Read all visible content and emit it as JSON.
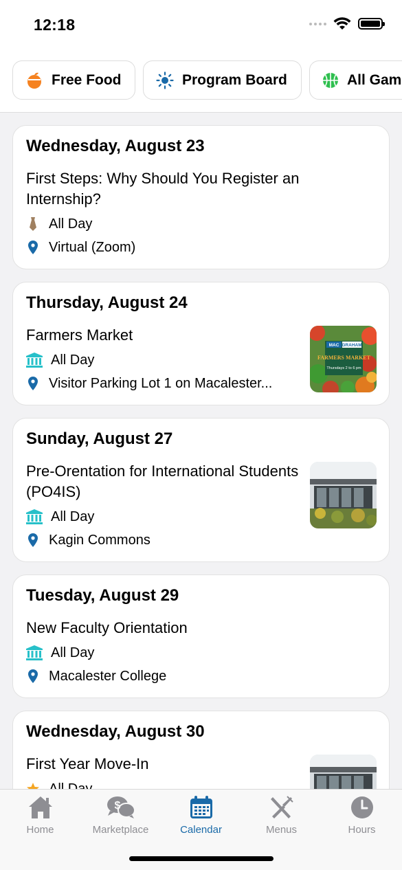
{
  "status_bar": {
    "time": "12:18"
  },
  "filters": [
    {
      "label": "Free Food",
      "icon": "orange-food-icon"
    },
    {
      "label": "Program Board",
      "icon": "sun-icon"
    },
    {
      "label": "All Gam",
      "icon": "basketball-icon"
    }
  ],
  "events": [
    {
      "date": "Wednesday, August 23",
      "title": "First Steps: Why Should You Register an Internship?",
      "time": "All Day",
      "location": "Virtual (Zoom)",
      "category_icon": "tie-icon"
    },
    {
      "date": "Thursday, August 24",
      "title": "Farmers Market",
      "time": "All Day",
      "location": "Visitor Parking Lot 1 on Macalester...",
      "category_icon": "building-icon",
      "thumb": {
        "brand_a": "MAC",
        "brand_b": "GRAHAM",
        "heading": "FARMERS MARKET",
        "sub": "Thursdays 2 to 6 pm"
      }
    },
    {
      "date": "Sunday, August 27",
      "title": "Pre-Orentation for International Students (PO4IS)",
      "time": "All Day",
      "location": "Kagin Commons",
      "category_icon": "building-icon"
    },
    {
      "date": "Tuesday, August 29",
      "title": "New Faculty Orientation",
      "time": "All Day",
      "location": "Macalester College",
      "category_icon": "building-icon"
    },
    {
      "date": "Wednesday, August 30",
      "title": "First Year Move-In",
      "time": "All Day",
      "location": "",
      "category_icon": "star-icon"
    }
  ],
  "tabs": [
    {
      "label": "Home",
      "icon": "home-icon"
    },
    {
      "label": "Marketplace",
      "icon": "marketplace-icon"
    },
    {
      "label": "Calendar",
      "icon": "calendar-icon",
      "active": true
    },
    {
      "label": "Menus",
      "icon": "utensils-icon"
    },
    {
      "label": "Hours",
      "icon": "clock-icon"
    }
  ],
  "colors": {
    "accent": "#1a6aa8",
    "location_pin": "#1a6aa8",
    "building": "#27c0c9",
    "tie": "#a08060",
    "star": "#f5a623",
    "tab_inactive": "#8e8e93"
  }
}
